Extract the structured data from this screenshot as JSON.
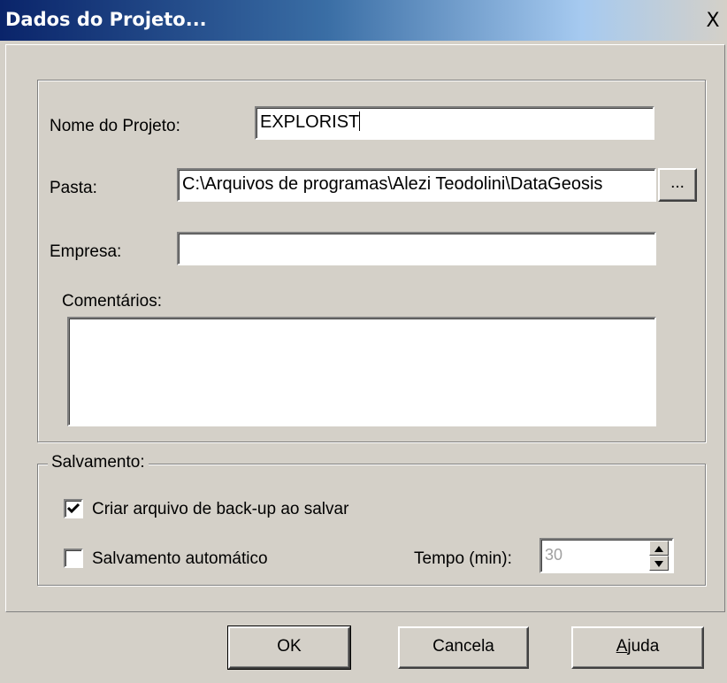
{
  "window": {
    "title": "Dados do Projeto..."
  },
  "titlebar": {
    "close_glyph": "X"
  },
  "form": {
    "nome_label": "Nome do Projeto:",
    "nome_value": "EXPLORIST",
    "pasta_label": "Pasta:",
    "pasta_value": "C:\\Arquivos de programas\\Alezi Teodolini\\DataGeosis",
    "browse_label": "...",
    "empresa_label": "Empresa:",
    "empresa_value": "",
    "comentarios_label": "Comentários:",
    "comentarios_value": ""
  },
  "salvamento": {
    "legend": "Salvamento:",
    "backup_label": "Criar arquivo de back-up ao salvar",
    "backup_checked": true,
    "auto_label": "Salvamento automático",
    "auto_checked": false,
    "tempo_label": "Tempo (min):",
    "tempo_value": "30"
  },
  "buttons": {
    "ok": "OK",
    "cancel": "Cancela",
    "help_underlined_letter": "A",
    "help_rest": "juda"
  },
  "icons": {
    "close": "close-icon",
    "check": "checkmark-icon",
    "spin_up": "triangle-up-icon",
    "spin_down": "triangle-down-icon"
  }
}
